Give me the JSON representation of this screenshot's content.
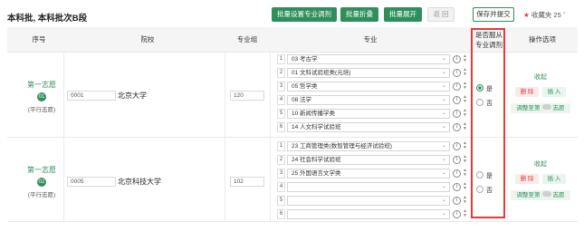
{
  "header": {
    "title": "本科批, 本科批次B段",
    "buttons": {
      "batch_set_adjust": "批量设置专业调剂",
      "batch_collapse": "批量折叠",
      "batch_expand": "批量展开",
      "back": "返 回",
      "save_submit": "保存并提交"
    },
    "favorites": "收藏夹 25"
  },
  "columns": {
    "seq": "序号",
    "school": "院校",
    "group": "专业组",
    "major": "专业",
    "adjust_line1": "是否服从",
    "adjust_line2": "专业调剂",
    "ops": "操作选项"
  },
  "rows": [
    {
      "vol_name": "第一志愿",
      "vol_badge": "01",
      "vol_note": "(平行志愿)",
      "school_code": "0001",
      "school_name": "北京大学",
      "group_code": "120",
      "majors": [
        {
          "n": "1",
          "name": "03 考古学"
        },
        {
          "n": "2",
          "name": "01 文科试验班类(元培)"
        },
        {
          "n": "3",
          "name": "05 哲学类"
        },
        {
          "n": "4",
          "name": "08 法学"
        },
        {
          "n": "5",
          "name": "10 新闻传播学类"
        },
        {
          "n": "6",
          "name": "14 人文科学试验班"
        }
      ],
      "adjust_yes": "是",
      "adjust_no": "否",
      "adjust_selected": "yes",
      "op_collapse": "收起",
      "op_delete": "删 除",
      "op_insert": "插 入",
      "op_adjust": "调整至第",
      "op_vol": "志愿"
    },
    {
      "vol_name": "第一志愿",
      "vol_badge": "02",
      "vol_note": "(平行志愿)",
      "school_code": "0005",
      "school_name": "北京科技大学",
      "group_code": "102",
      "majors": [
        {
          "n": "1",
          "name": "23 工商管理类(数智管理与经济试验班)"
        },
        {
          "n": "2",
          "name": "24 社会科学试验班"
        },
        {
          "n": "3",
          "name": "25 外国语言文学类"
        },
        {
          "n": "4",
          "name": ""
        },
        {
          "n": "5",
          "name": ""
        },
        {
          "n": "6",
          "name": ""
        }
      ],
      "adjust_yes": "是",
      "adjust_no": "否",
      "adjust_selected": "none",
      "op_collapse": "收起",
      "op_delete": "删 除",
      "op_insert": "插 入",
      "op_adjust": "调整至第",
      "op_vol": "志愿"
    }
  ],
  "colors": {
    "accent": "#2f8f5b",
    "highlight": "#e23b3b"
  }
}
